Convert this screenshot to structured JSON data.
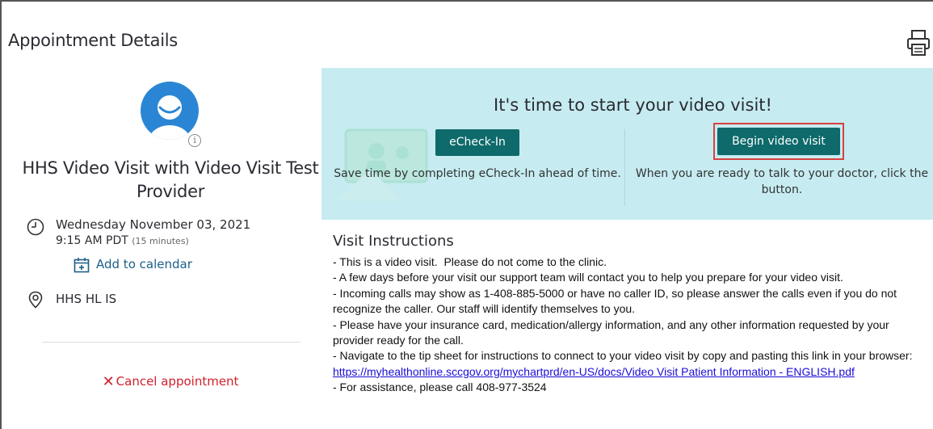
{
  "header": {
    "title": "Appointment Details",
    "print_icon": "printer-icon"
  },
  "appointment": {
    "avatar_icon": "provider-avatar",
    "info_badge": "i",
    "title": "HHS Video Visit with Video Visit Test Provider",
    "date": "Wednesday November 03, 2021",
    "time": "9:15 AM PDT",
    "duration": "(15 minutes)",
    "add_to_calendar": "Add to calendar",
    "location": "HHS HL IS",
    "cancel_label": "Cancel appointment"
  },
  "banner": {
    "title": "It's time to start your video visit!",
    "echeckin_label": "eCheck-In",
    "echeckin_desc": "Save time by completing eCheck-In ahead of time.",
    "begin_label": "Begin video visit",
    "begin_desc": "When you are ready to talk to your doctor, click the button."
  },
  "instructions": {
    "title": "Visit Instructions",
    "line1": "- This is a video visit.  Please do not come to the clinic.",
    "line2": "- A few days before your visit our support team will contact you to help you prepare for your video visit.",
    "line3": "- Incoming calls may show as 1-408-885-5000 or have no caller ID, so please answer the calls even if you do not recognize the caller. Our staff will identify themselves to you.",
    "line4": "- Please have your insurance card, medication/allergy information, and any other information requested by your provider ready for the call.",
    "line5": "- Navigate to the tip sheet for instructions to connect to your video visit by copy and pasting this link in your browser: ",
    "link": "https://myhealthonline.sccgov.org/mychartprd/en-US/docs/Video Visit Patient Information - ENGLISH.pdf",
    "line6": "- For assistance, please call 408-977-3524"
  },
  "colors": {
    "accent_button": "#0e6a6b",
    "banner_bg": "#c6ecf1",
    "highlight_border": "#d94040",
    "cancel_red": "#d0202a",
    "link_blue": "#1b5f88"
  }
}
